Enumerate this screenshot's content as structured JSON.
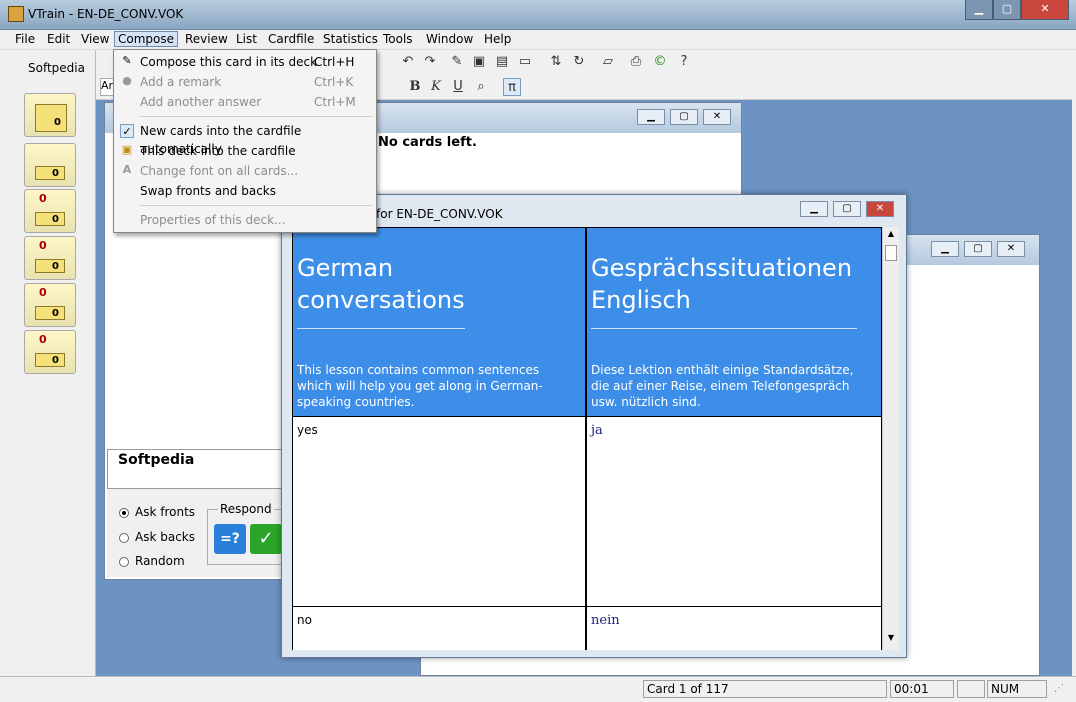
{
  "window": {
    "title": "VTrain - EN-DE_CONV.VOK"
  },
  "menubar": [
    "File",
    "Edit",
    "View",
    "Compose",
    "Review",
    "List",
    "Cardfile",
    "Statistics",
    "Tools",
    "Window",
    "Help"
  ],
  "sidebar": {
    "label": "Softpedia",
    "boxes": [
      {
        "count": "0"
      },
      {
        "count": "0"
      },
      {
        "count": "0"
      },
      {
        "count": "0"
      },
      {
        "count": "0"
      },
      {
        "count": "0"
      }
    ]
  },
  "compose_menu": {
    "items": [
      {
        "label": "Compose this card in its deck",
        "shortcut": "Ctrl+H",
        "enabled": true
      },
      {
        "label": "Add a remark",
        "shortcut": "Ctrl+K",
        "enabled": false
      },
      {
        "label": "Add another answer",
        "shortcut": "Ctrl+M",
        "enabled": false
      },
      {
        "label": "New cards into the cardfile automatically",
        "shortcut": "",
        "enabled": true,
        "checked": true
      },
      {
        "label": "This deck into the cardfile",
        "shortcut": "",
        "enabled": true
      },
      {
        "label": "Change font on all cards...",
        "shortcut": "",
        "enabled": false
      },
      {
        "label": "Swap fronts and backs",
        "shortcut": "",
        "enabled": true
      },
      {
        "label": "Properties of this deck...",
        "shortcut": "",
        "enabled": false
      }
    ]
  },
  "review_window": {
    "no_cards": "No cards left.",
    "softpedia": "Softpedia",
    "respond": "Respond",
    "options": [
      {
        "label": "Ask fronts",
        "selected": true
      },
      {
        "label": "Ask backs",
        "selected": false
      },
      {
        "label": "Random",
        "selected": false
      }
    ]
  },
  "card_window": {
    "title": "for EN-DE_CONV.VOK",
    "header_left": {
      "title1": "German",
      "title2": "conversations",
      "desc": "This lesson contains common sentences which will help you get along in German-speaking countries."
    },
    "header_right": {
      "title1": "Gesprächssituationen",
      "title2": "Englisch",
      "desc": "Diese Lektion enthält einige Standardsätze, die auf einer Reise, einem Telefongespräch usw. nützlich sind."
    },
    "rows": [
      {
        "front": "yes",
        "back": "ja"
      },
      {
        "front": "no",
        "back": "nein"
      }
    ]
  },
  "statusbar": {
    "card": "Card 1 of 117",
    "time": "00:01",
    "num": "NUM"
  },
  "colors": {
    "header_blue": "#3d8ee8"
  }
}
